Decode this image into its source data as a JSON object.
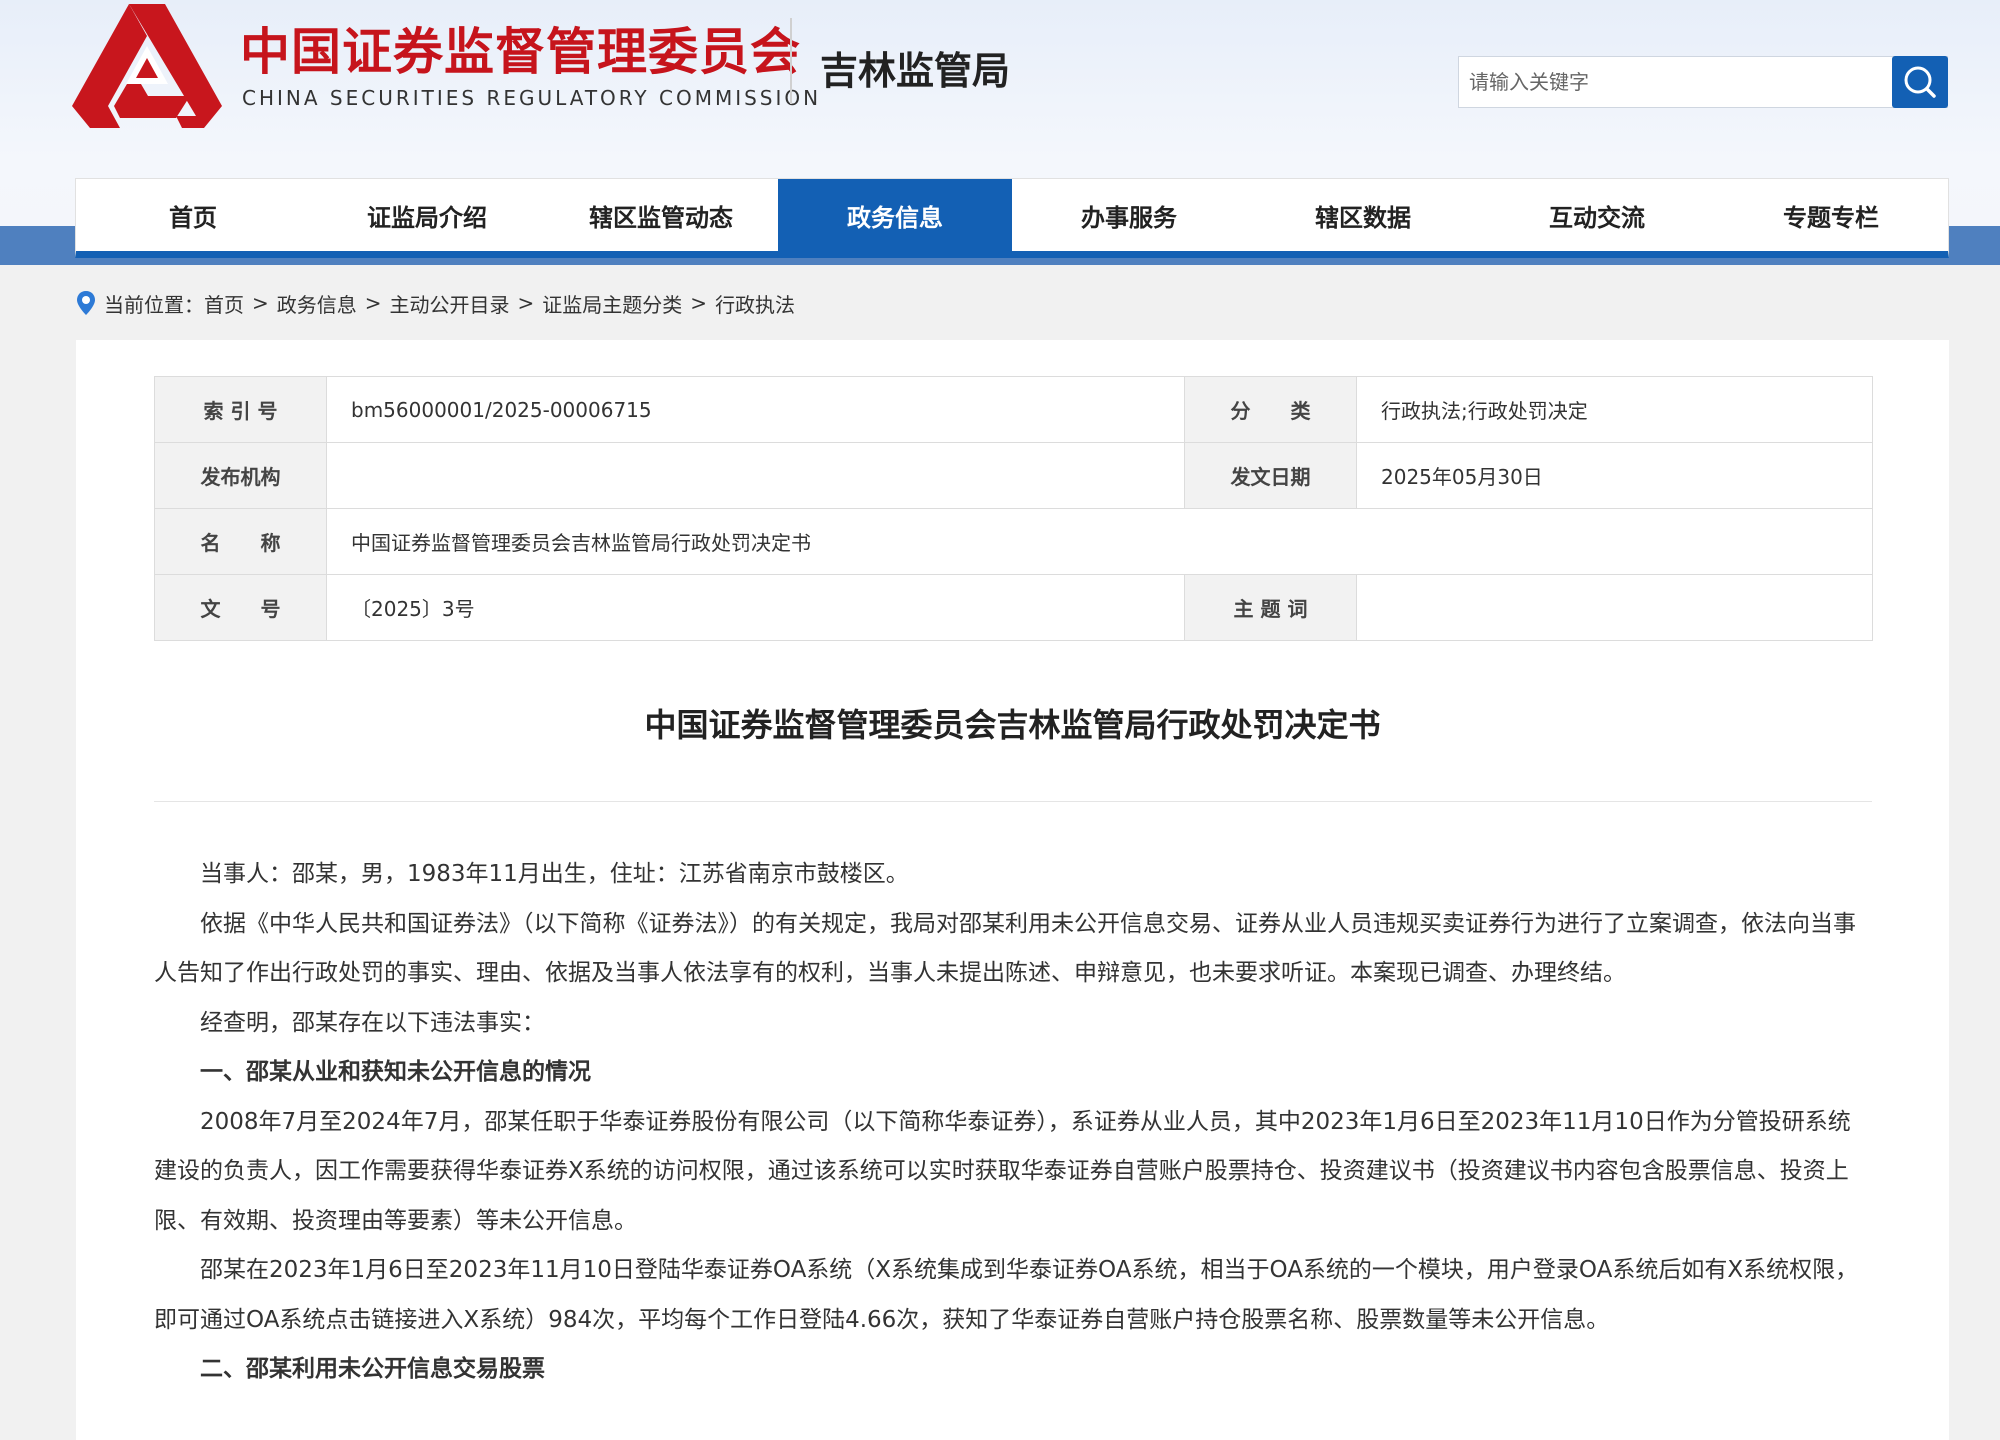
{
  "header": {
    "org_cn": "中国证券监督管理委员会",
    "org_en": "CHINA SECURITIES REGULATORY COMMISSION",
    "bureau": "吉林监管局",
    "search_placeholder": "请输入关键字"
  },
  "nav": {
    "items": [
      "首页",
      "证监局介绍",
      "辖区监管动态",
      "政务信息",
      "办事服务",
      "辖区数据",
      "互动交流",
      "专题专栏"
    ],
    "active": "政务信息"
  },
  "breadcrumb": {
    "label": "当前位置：",
    "items": [
      "首页",
      "政务信息",
      "主动公开目录",
      "证监局主题分类",
      "行政执法"
    ],
    "separator": ">"
  },
  "meta": {
    "index_label": "索 引 号",
    "index_value": "bm56000001/2025-00006715",
    "category_label": "分　　类",
    "category_value": "行政执法;行政处罚决定",
    "publisher_label": "发布机构",
    "publisher_value": "",
    "date_label": "发文日期",
    "date_value": "2025年05月30日",
    "name_label": "名　　称",
    "name_value": "中国证券监督管理委员会吉林监管局行政处罚决定书",
    "docno_label": "文　　号",
    "docno_value": "〔2025〕3号",
    "keywords_label": "主 题 词",
    "keywords_value": ""
  },
  "document": {
    "title": "中国证券监督管理委员会吉林监管局行政处罚决定书",
    "paragraphs": [
      {
        "type": "text",
        "text": "当事人：邵某，男，1983年11月出生，住址：江苏省南京市鼓楼区。"
      },
      {
        "type": "text",
        "text": "依据《中华人民共和国证券法》（以下简称《证券法》）的有关规定，我局对邵某利用未公开信息交易、证券从业人员违规买卖证券行为进行了立案调查，依法向当事人告知了作出行政处罚的事实、理由、依据及当事人依法享有的权利，当事人未提出陈述、申辩意见，也未要求听证。本案现已调查、办理终结。"
      },
      {
        "type": "text",
        "text": "经查明，邵某存在以下违法事实："
      },
      {
        "type": "heading",
        "text": "一、邵某从业和获知未公开信息的情况"
      },
      {
        "type": "text",
        "text": "2008年7月至2024年7月，邵某任职于华泰证券股份有限公司（以下简称华泰证券），系证券从业人员，其中2023年1月6日至2023年11月10日作为分管投研系统建设的负责人，因工作需要获得华泰证券X系统的访问权限，通过该系统可以实时获取华泰证券自营账户股票持仓、投资建议书（投资建议书内容包含股票信息、投资上限、有效期、投资理由等要素）等未公开信息。"
      },
      {
        "type": "text",
        "text": "邵某在2023年1月6日至2023年11月10日登陆华泰证券OA系统（X系统集成到华泰证券OA系统，相当于OA系统的一个模块，用户登录OA系统后如有X系统权限，即可通过OA系统点击链接进入X系统）984次，平均每个工作日登陆4.66次，获知了华泰证券自营账户持仓股票名称、股票数量等未公开信息。"
      },
      {
        "type": "heading",
        "text": "二、邵某利用未公开信息交易股票"
      }
    ]
  }
}
